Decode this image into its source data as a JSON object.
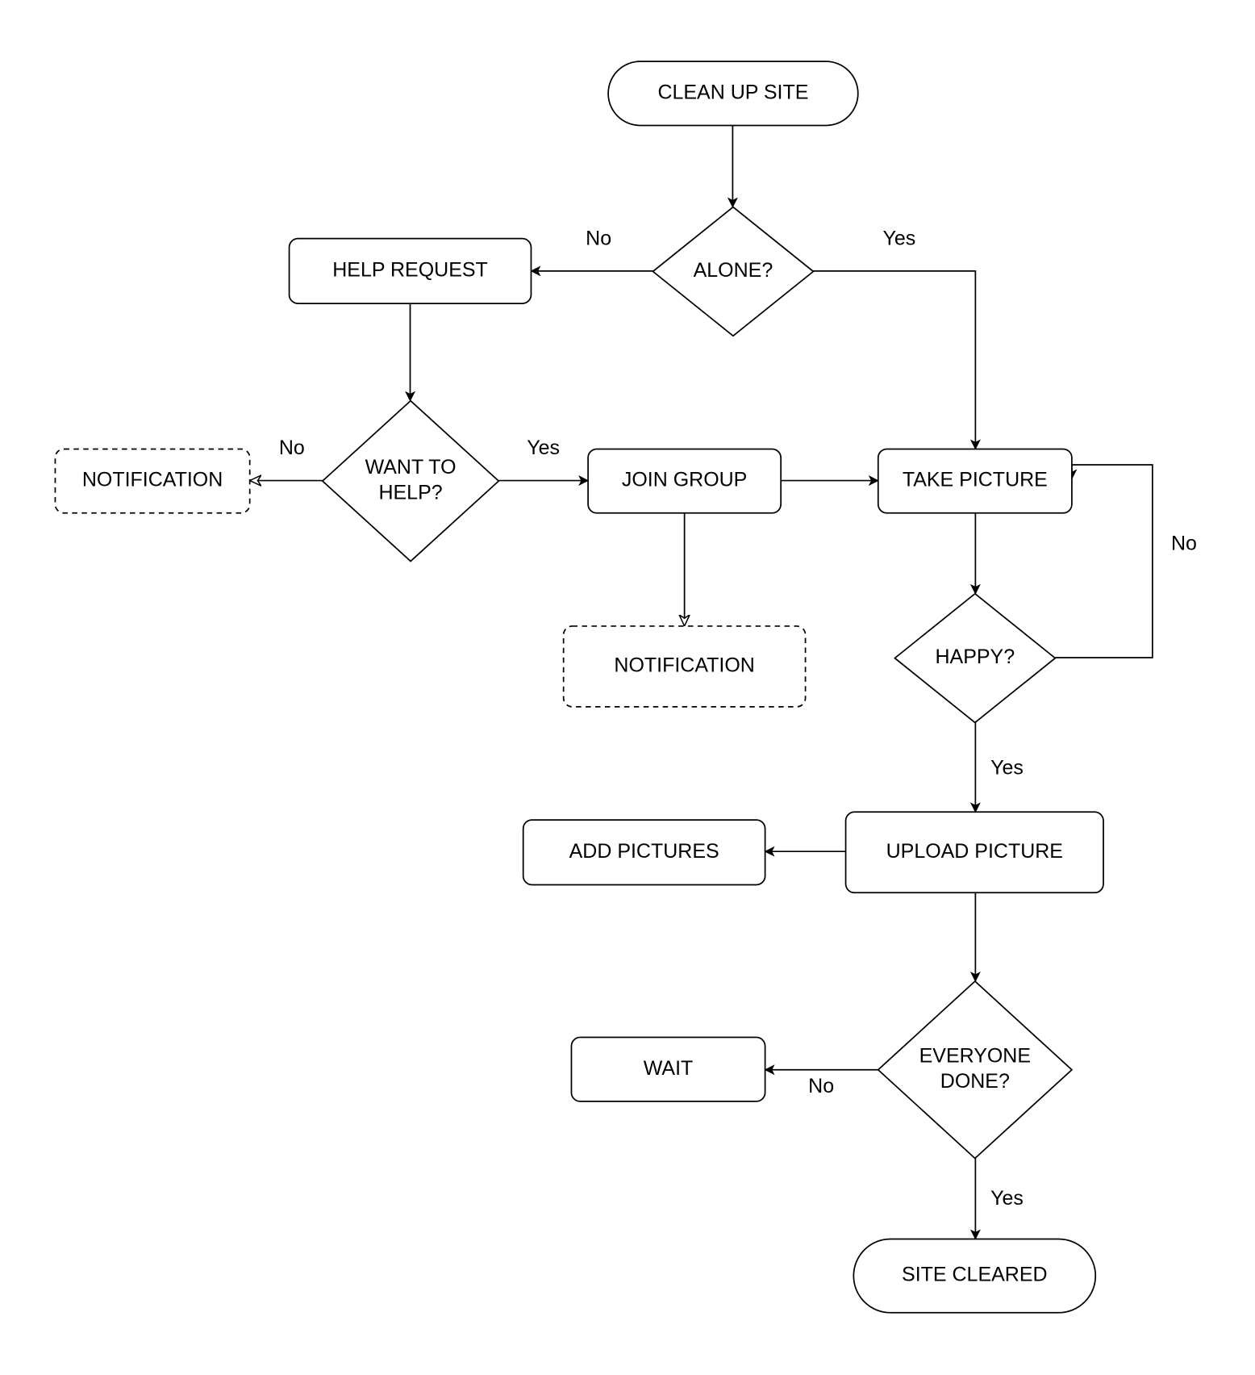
{
  "diagram": {
    "type": "flowchart",
    "nodes": [
      {
        "id": "clean_up_site",
        "shape": "terminator",
        "lines": [
          "CLEAN UP SITE"
        ]
      },
      {
        "id": "alone",
        "shape": "decision",
        "lines": [
          "ALONE?"
        ]
      },
      {
        "id": "help_request",
        "shape": "process",
        "lines": [
          "HELP REQUEST"
        ]
      },
      {
        "id": "want_to_help",
        "shape": "decision",
        "lines": [
          "WANT TO",
          "HELP?"
        ]
      },
      {
        "id": "notification_1",
        "shape": "process-dashed",
        "lines": [
          "NOTIFICATION"
        ]
      },
      {
        "id": "join_group",
        "shape": "process",
        "lines": [
          "JOIN GROUP"
        ]
      },
      {
        "id": "notification_2",
        "shape": "process-dashed",
        "lines": [
          "NOTIFICATION"
        ]
      },
      {
        "id": "take_picture",
        "shape": "process",
        "lines": [
          "TAKE PICTURE"
        ]
      },
      {
        "id": "happy",
        "shape": "decision",
        "lines": [
          "HAPPY?"
        ]
      },
      {
        "id": "upload_picture",
        "shape": "process",
        "lines": [
          "UPLOAD PICTURE"
        ]
      },
      {
        "id": "add_pictures",
        "shape": "process",
        "lines": [
          "ADD PICTURES"
        ]
      },
      {
        "id": "everyone_done",
        "shape": "decision",
        "lines": [
          "EVERYONE",
          "DONE?"
        ]
      },
      {
        "id": "wait",
        "shape": "process",
        "lines": [
          "WAIT"
        ]
      },
      {
        "id": "site_cleared",
        "shape": "terminator",
        "lines": [
          "SITE CLEARED"
        ]
      }
    ],
    "edges": [
      {
        "id": "e1",
        "from": "clean_up_site",
        "to": "alone",
        "label": "",
        "arrow": "filled"
      },
      {
        "id": "e2",
        "from": "alone",
        "to": "help_request",
        "label": "No",
        "arrow": "filled"
      },
      {
        "id": "e3",
        "from": "alone",
        "to": "take_picture",
        "label": "Yes",
        "arrow": "filled"
      },
      {
        "id": "e4",
        "from": "help_request",
        "to": "want_to_help",
        "label": "",
        "arrow": "filled"
      },
      {
        "id": "e5",
        "from": "want_to_help",
        "to": "notification_1",
        "label": "No",
        "arrow": "open"
      },
      {
        "id": "e6",
        "from": "want_to_help",
        "to": "join_group",
        "label": "Yes",
        "arrow": "filled"
      },
      {
        "id": "e7",
        "from": "join_group",
        "to": "take_picture",
        "label": "",
        "arrow": "filled"
      },
      {
        "id": "e8",
        "from": "join_group",
        "to": "notification_2",
        "label": "",
        "arrow": "open"
      },
      {
        "id": "e9",
        "from": "take_picture",
        "to": "happy",
        "label": "",
        "arrow": "filled"
      },
      {
        "id": "e10",
        "from": "happy",
        "to": "take_picture",
        "label": "No",
        "arrow": "filled"
      },
      {
        "id": "e11",
        "from": "happy",
        "to": "upload_picture",
        "label": "Yes",
        "arrow": "filled"
      },
      {
        "id": "e12",
        "from": "upload_picture",
        "to": "add_pictures",
        "label": "",
        "arrow": "filled"
      },
      {
        "id": "e13",
        "from": "upload_picture",
        "to": "everyone_done",
        "label": "",
        "arrow": "filled"
      },
      {
        "id": "e14",
        "from": "everyone_done",
        "to": "wait",
        "label": "No",
        "arrow": "filled"
      },
      {
        "id": "e15",
        "from": "everyone_done",
        "to": "site_cleared",
        "label": "Yes",
        "arrow": "filled"
      }
    ],
    "colors": {
      "stroke": "#000000",
      "fill": "#ffffff",
      "text": "#000000",
      "background": "#ffffff"
    }
  }
}
